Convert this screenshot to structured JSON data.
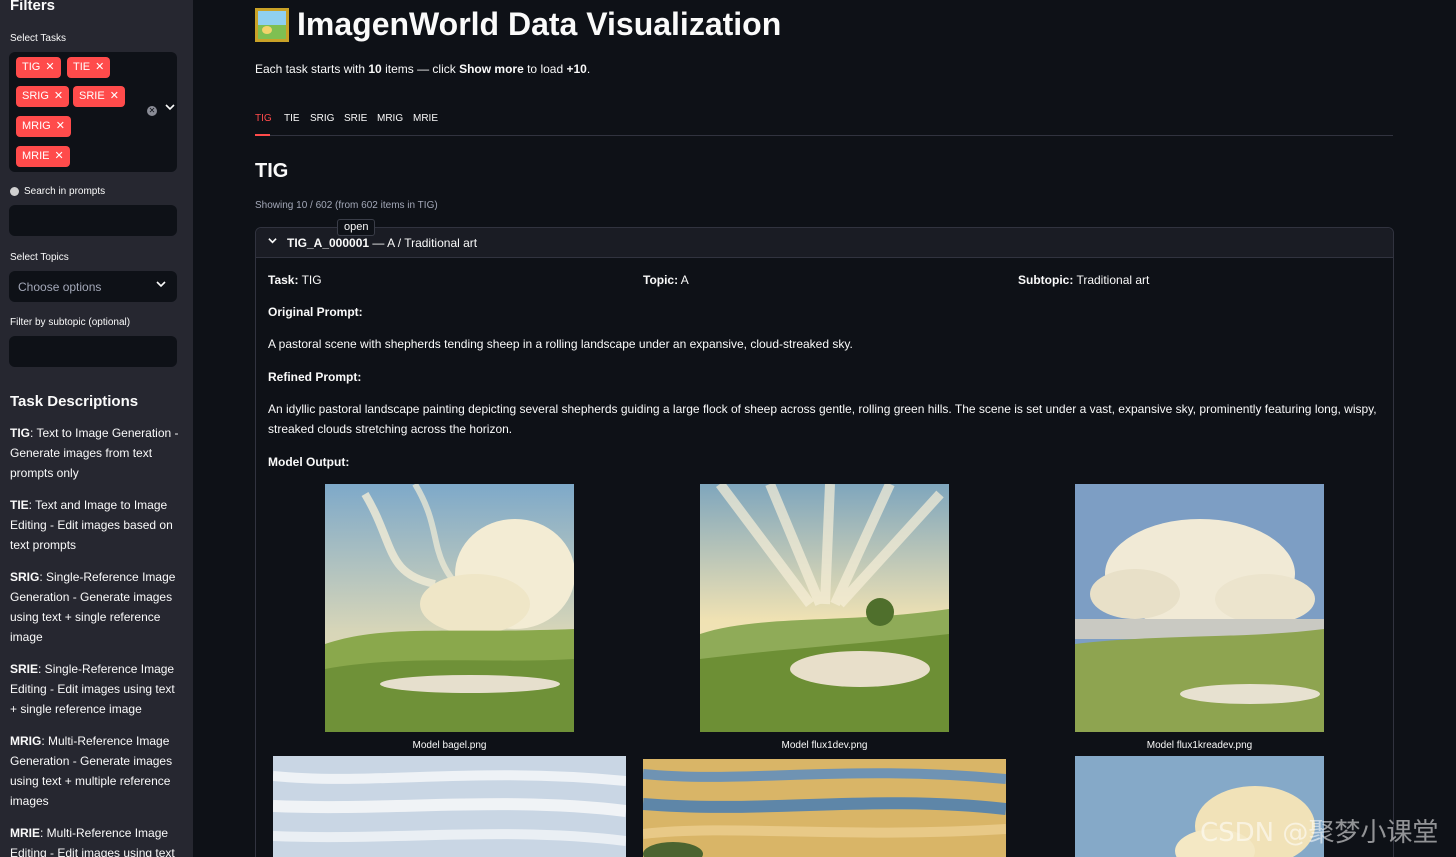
{
  "sidebar": {
    "title": "Filters",
    "tasks_label": "Select Tasks",
    "task_chips": [
      "TIG",
      "TIE",
      "SRIG",
      "SRIE",
      "MRIG",
      "MRIE"
    ],
    "search_label": "Search in prompts",
    "topics_label": "Select Topics",
    "topics_placeholder": "Choose options",
    "subtopic_label": "Filter by subtopic (optional)",
    "descriptions_title": "Task Descriptions",
    "descriptions": [
      {
        "key": "TIG",
        "text": ": Text to Image Generation - Generate images from text prompts only"
      },
      {
        "key": "TIE",
        "text": ": Text and Image to Image Editing - Edit images based on text prompts"
      },
      {
        "key": "SRIG",
        "text": ": Single-Reference Image Generation - Generate images using text + single reference image"
      },
      {
        "key": "SRIE",
        "text": ": Single-Reference Image Editing - Edit images using text + single reference image"
      },
      {
        "key": "MRIG",
        "text": ": Multi-Reference Image Generation - Generate images using text + multiple reference images"
      },
      {
        "key": "MRIE",
        "text": ": Multi-Reference Image Editing - Edit images using text +"
      }
    ]
  },
  "main": {
    "title": "ImagenWorld Data Visualization",
    "subline": {
      "a": "Each task starts with ",
      "b": "10",
      "c": " items — click ",
      "d": "Show more",
      "e": " to load ",
      "f": "+10",
      "g": "."
    },
    "tabs": [
      "TIG",
      "TIE",
      "SRIG",
      "SRIE",
      "MRIG",
      "MRIE"
    ],
    "section_title": "TIG",
    "showing": "Showing 10 / 602 (from 602 items in TIG)",
    "tooltip": "open",
    "expander": {
      "id": "TIG_A_000001",
      "rest": " — A / Traditional art",
      "task_label": "Task:",
      "task_value": " TIG",
      "topic_label": "Topic:",
      "topic_value": " A",
      "subtopic_label": "Subtopic:",
      "subtopic_value": " Traditional art",
      "original_prompt_label": "Original Prompt:",
      "original_prompt": "A pastoral scene with shepherds tending sheep in a rolling landscape under an expansive, cloud-streaked sky.",
      "refined_prompt_label": "Refined Prompt:",
      "refined_prompt": "An idyllic pastoral landscape painting depicting several shepherds guiding a large flock of sheep across gentle, rolling green hills. The scene is set under a vast, expansive sky, prominently featuring long, wispy, streaked clouds stretching across the horizon.",
      "model_output_label": "Model Output:",
      "captions": [
        "Model bagel.png",
        "Model flux1dev.png",
        "Model flux1kreadev.png"
      ]
    }
  },
  "watermark": "CSDN @聚梦小课堂",
  "colors": {
    "accent": "#ff4b4b",
    "bg": "#0e1117",
    "sidebar": "#262730"
  }
}
